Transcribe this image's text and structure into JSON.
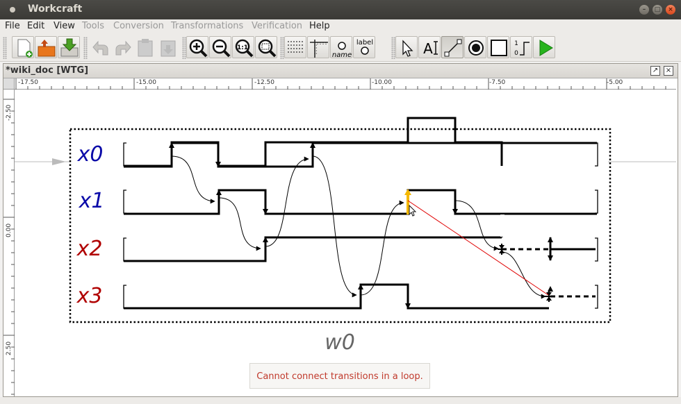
{
  "window": {
    "title": "Workcraft"
  },
  "menubar": {
    "items": [
      {
        "label": "File",
        "enabled": true
      },
      {
        "label": "Edit",
        "enabled": true
      },
      {
        "label": "View",
        "enabled": true
      },
      {
        "label": "Tools",
        "enabled": false
      },
      {
        "label": "Conversion",
        "enabled": false
      },
      {
        "label": "Transformations",
        "enabled": false
      },
      {
        "label": "Verification",
        "enabled": false
      },
      {
        "label": "Help",
        "enabled": true
      }
    ]
  },
  "toolbar": {
    "label_tool_text": "label",
    "name_tool_text": "name",
    "signal_level_tool_text": [
      "1",
      "0"
    ]
  },
  "editor": {
    "tab_title": "*wiki_doc [WTG]",
    "ruler_h_labels": [
      "-17.50",
      "-15.00",
      "-12.50",
      "-10.00",
      "-7.50",
      "-5.00"
    ],
    "ruler_v_labels": [
      "-2.50",
      "0.00",
      "2.50"
    ]
  },
  "diagram": {
    "waveform_name": "w0",
    "signals": [
      {
        "name": "x0",
        "kind": "input",
        "color": "#0a0aa8"
      },
      {
        "name": "x1",
        "kind": "input",
        "color": "#0a0aa8"
      },
      {
        "name": "x2",
        "kind": "output",
        "color": "#b00000"
      },
      {
        "name": "x3",
        "kind": "output",
        "color": "#b00000"
      }
    ],
    "highlight_color": "#f5b800",
    "error_edge_color": "#e00000"
  },
  "status": {
    "error_message": "Cannot connect transitions in a loop."
  }
}
